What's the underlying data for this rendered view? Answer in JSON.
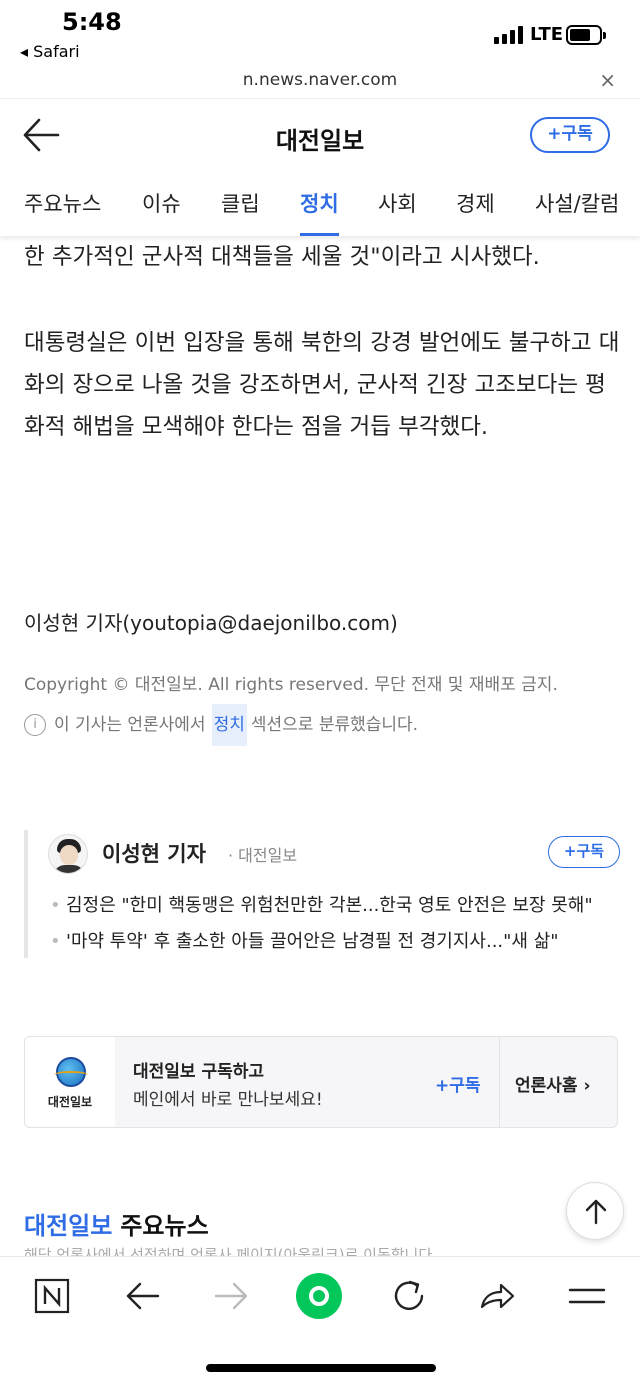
{
  "status_bar": {
    "time": "5:48",
    "back_app": "◂ Safari",
    "network": "LTE"
  },
  "browser": {
    "url": "n.news.naver.com",
    "close_icon": "×"
  },
  "header": {
    "back_icon": "back-arrow-icon",
    "title": "대전일보",
    "subscribe_label": "+구독"
  },
  "tabs": [
    {
      "label": "주요뉴스"
    },
    {
      "label": "이슈"
    },
    {
      "label": "클립"
    },
    {
      "label": "정치",
      "active": true
    },
    {
      "label": "사회"
    },
    {
      "label": "경제"
    },
    {
      "label": "사설/칼럼"
    }
  ],
  "article": {
    "paragraph_1": "한 추가적인 군사적 대책들을 세울 것\"이라고 시사했다.",
    "paragraph_2": "대통령실은 이번 입장을 통해 북한의 강경 발언에도 불구하고 대화의 장으로 나올 것을 강조하면서, 군사적 긴장 고조보다는 평화적 해법을 모색해야 한다는 점을 거듭 부각했다.",
    "reporter_line": "이성현 기자(youtopia@daejonilbo.com)",
    "copyright": "Copyright © 대전일보. All rights reserved. 무단 전재 및 재배포 금지.",
    "section_note_before": "이 기사는 언론사에서",
    "section_note_link": "정치",
    "section_note_after": "섹션으로 분류했습니다."
  },
  "reporter_card": {
    "name": "이성현 기자",
    "org": "· 대전일보",
    "subscribe_label": "+구독",
    "articles": [
      "김정은 \"한미 핵동맹은 위험천만한 각본...한국 영토 안전은 보장 못해\"",
      "'마약 투약' 후 출소한 아들 끌어안은 남경필 전 경기지사...\"새 삶\""
    ]
  },
  "publisher_card": {
    "logo_text": "대전일보",
    "title": "대전일보 구독하고",
    "description": "메인에서 바로 만나보세요!",
    "subscribe_label": "+구독",
    "home_label": "언론사홈 ›"
  },
  "main_news": {
    "org": "대전일보",
    "label": "주요뉴스",
    "subtitle": "해당 언론사에서 선정하며 언론사 페이지(아웃링크)로 이동합니다."
  },
  "toolbar": {
    "buttons": [
      "naver-n-icon",
      "back-icon",
      "forward-icon",
      "green-dot-icon",
      "refresh-icon",
      "share-icon",
      "menu-icon"
    ]
  },
  "colors": {
    "accent": "#2f6ce5",
    "green": "#03c75a"
  }
}
